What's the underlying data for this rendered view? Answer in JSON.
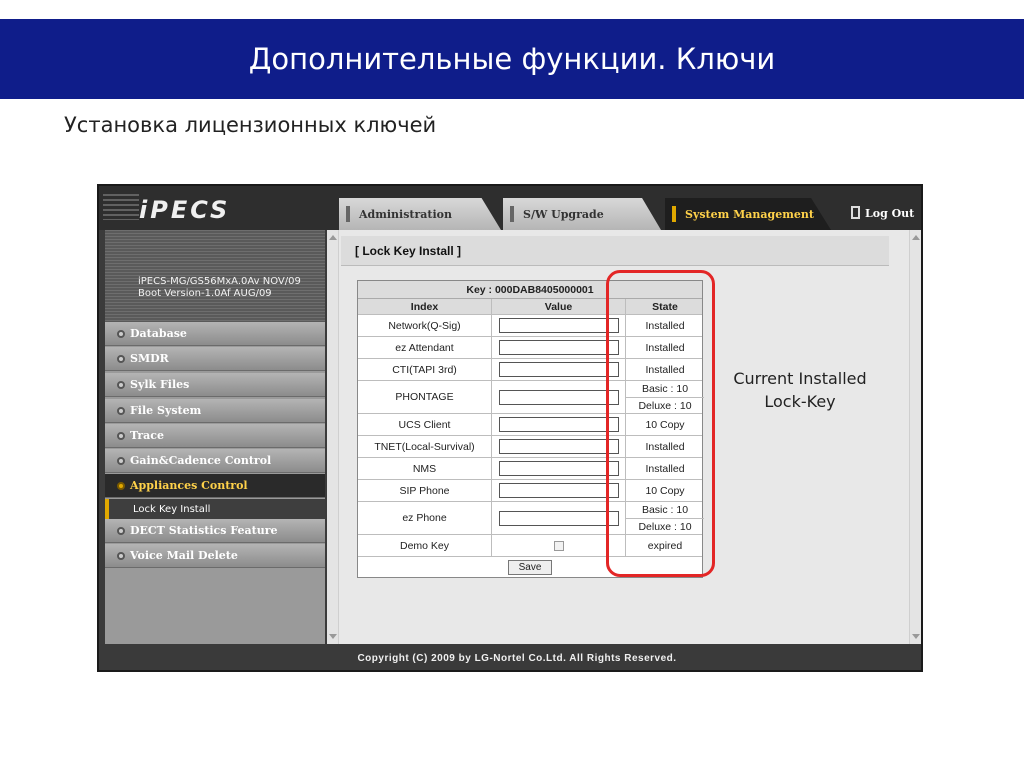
{
  "slide": {
    "title": "Дополнительные функции. Ключи",
    "subtitle": "Установка лицензионных ключей",
    "callout_line1": "Current Installed",
    "callout_line2": "Lock-Key",
    "highlight_color": "#e32626",
    "title_bar_color": "#0f1d8a"
  },
  "app": {
    "logo": "iPECS",
    "tabs": [
      {
        "label": "Administration",
        "active": false
      },
      {
        "label": "S/W Upgrade",
        "active": false
      },
      {
        "label": "System Management",
        "active": true
      }
    ],
    "logout_label": "Log Out",
    "active_tab_color": "#ffd24a"
  },
  "sidebar": {
    "info_line1": "iPECS-MG/GS56MxA.0Av NOV/09",
    "info_line2": "Boot Version-1.0Af AUG/09",
    "items": [
      {
        "label": "Database"
      },
      {
        "label": "SMDR"
      },
      {
        "label": "Sylk Files"
      },
      {
        "label": "File System"
      },
      {
        "label": "Trace"
      },
      {
        "label": "Gain&Cadence Control"
      },
      {
        "label": "Appliances Control",
        "active": true
      },
      {
        "label": "DECT Statistics Feature"
      },
      {
        "label": "Voice Mail Delete"
      }
    ],
    "sub_item": "Lock Key Install"
  },
  "content": {
    "heading": "[ Lock Key Install ]",
    "key_label": "Key : 000DAB8405000001",
    "columns": {
      "index": "Index",
      "value": "Value",
      "state": "State"
    },
    "rows": [
      {
        "index": "Network(Q-Sig)",
        "state": "Installed"
      },
      {
        "index": "ez Attendant",
        "state": "Installed"
      },
      {
        "index": "CTI(TAPI 3rd)",
        "state": "Installed"
      },
      {
        "index": "PHONTAGE",
        "state_basic": "Basic : 10",
        "state_deluxe": "Deluxe : 10"
      },
      {
        "index": "UCS Client",
        "state": "10 Copy"
      },
      {
        "index": "TNET(Local-Survival)",
        "state": "Installed"
      },
      {
        "index": "NMS",
        "state": "Installed"
      },
      {
        "index": "SIP Phone",
        "state": "10 Copy"
      },
      {
        "index": "ez Phone",
        "state_basic": "Basic : 10",
        "state_deluxe": "Deluxe : 10"
      },
      {
        "index": "Demo Key",
        "state": "expired"
      }
    ],
    "save_label": "Save"
  },
  "footer": {
    "copyright": "Copyright (C) 2009 by LG-Nortel Co.Ltd. All Rights Reserved."
  }
}
